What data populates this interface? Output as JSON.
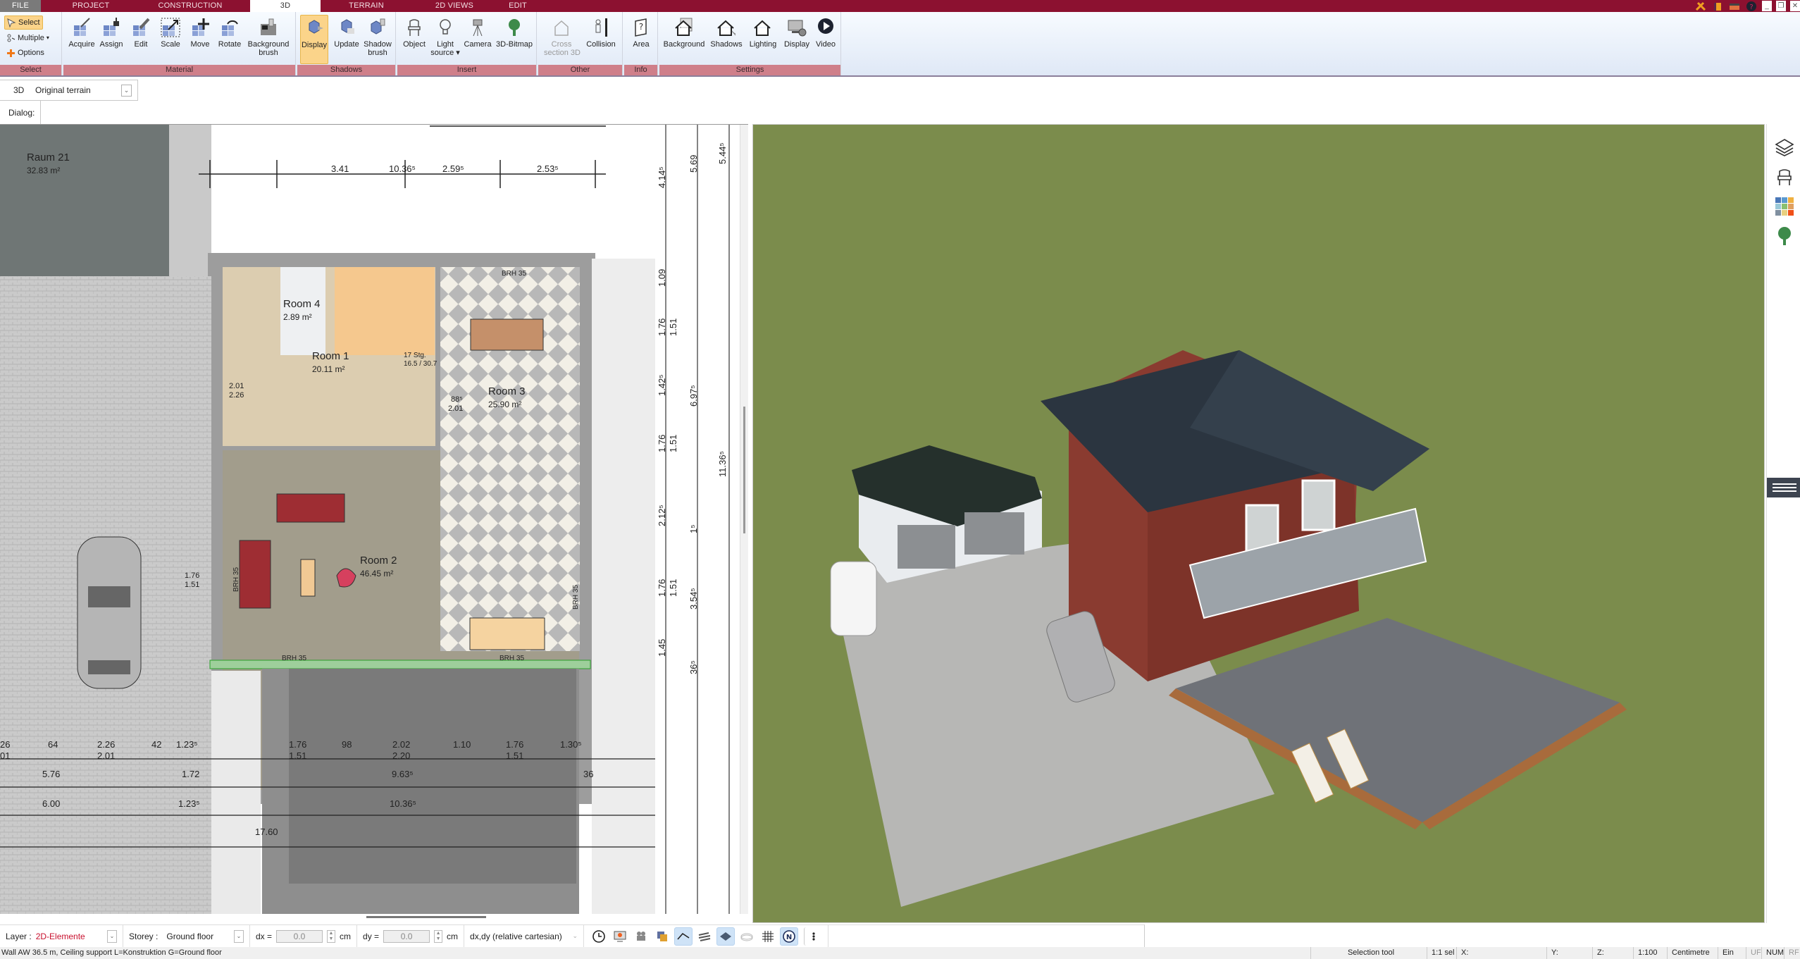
{
  "menubar": {
    "tabs": [
      {
        "label": "FILE"
      },
      {
        "label": "PROJECT"
      },
      {
        "label": "CONSTRUCTION"
      },
      {
        "label": "3D",
        "active": true
      },
      {
        "label": "TERRAIN"
      },
      {
        "label": "2D VIEWS"
      },
      {
        "label": "EDIT"
      }
    ],
    "window_controls": [
      "tools-icon",
      "clipboard-icon",
      "window-icon",
      "help-icon",
      "minimize",
      "restore",
      "close"
    ]
  },
  "ribbon": {
    "select_group": {
      "label": "Select",
      "items": [
        {
          "label": "Select",
          "active": true,
          "icon": "cursor-icon"
        },
        {
          "label": "Multiple",
          "icon": "multiple-select-icon"
        },
        {
          "label": "Options",
          "icon": "plus-icon"
        }
      ]
    },
    "material_group": {
      "label": "Material",
      "buttons": [
        {
          "label": "Acquire",
          "icon": "eyedropper-icon"
        },
        {
          "label": "Assign",
          "icon": "paint-bucket-icon"
        },
        {
          "label": "Edit",
          "icon": "pencil-icon"
        },
        {
          "label": "Scale",
          "icon": "scale-icon"
        },
        {
          "label": "Move",
          "icon": "move-icon"
        },
        {
          "label": "Rotate",
          "icon": "rotate-icon"
        },
        {
          "label": "Background\nbrush",
          "line1": "Background",
          "line2": "brush",
          "icon": "brush-icon"
        }
      ]
    },
    "shadows_group": {
      "label": "Shadows",
      "buttons": [
        {
          "label": "Display",
          "active": true,
          "icon": "cube-display-icon"
        },
        {
          "label": "Update",
          "icon": "cube-update-icon"
        },
        {
          "label": "Shadow brush",
          "line1": "Shadow",
          "line2": "brush",
          "icon": "shadow-brush-icon"
        }
      ]
    },
    "insert_group": {
      "label": "Insert",
      "buttons": [
        {
          "label": "Object",
          "icon": "chair-icon"
        },
        {
          "label": "Light source",
          "line1": "Light",
          "line2": "source ▾",
          "icon": "lightbulb-icon"
        },
        {
          "label": "Camera",
          "icon": "camera-icon"
        },
        {
          "label": "3D-Bitmap",
          "icon": "tree-icon"
        }
      ]
    },
    "other_group": {
      "label": "Other",
      "buttons": [
        {
          "label": "Cross section 3D",
          "line1": "Cross",
          "line2": "section 3D",
          "disabled": true,
          "icon": "cross-section-icon"
        },
        {
          "label": "Collision",
          "icon": "collision-icon"
        }
      ]
    },
    "info_group": {
      "label": "Info",
      "buttons": [
        {
          "label": "Area",
          "icon": "area-question-icon"
        }
      ]
    },
    "settings_group": {
      "label": "Settings",
      "buttons": [
        {
          "label": "Background",
          "icon": "house-background-icon"
        },
        {
          "label": "Shadows",
          "icon": "house-shadows-icon"
        },
        {
          "label": "Lighting",
          "icon": "house-lighting-icon"
        },
        {
          "label": "Display",
          "icon": "monitor-settings-icon"
        },
        {
          "label": "Video",
          "icon": "play-icon"
        }
      ]
    }
  },
  "subtoolbar": {
    "view_label": "3D",
    "terrain_select": "Original terrain",
    "dialog_label": "Dialog:"
  },
  "plan": {
    "rooms": [
      {
        "name": "Raum 21",
        "area": "32.83 m²"
      },
      {
        "name": "Room 4",
        "area": "2.89 m²"
      },
      {
        "name": "Room 1",
        "area": "20.11 m²"
      },
      {
        "name": "Room 3",
        "area": "25.90 m²"
      },
      {
        "name": "Room 2",
        "area": "46.45 m²"
      }
    ],
    "stairs": {
      "steps": "17 Stg.",
      "ratio": "16.5 / 30.7"
    },
    "top_dims": [
      "3.41",
      "10.36⁵",
      "2.59⁵",
      "2.53⁵"
    ],
    "right_dims": [
      "4.14⁵",
      "5.69",
      "5.44⁵",
      "1.09",
      "1.76",
      "1.51",
      "1.42⁵",
      "6.97⁵",
      "1.76",
      "1.51",
      "2.12⁵",
      "11.36⁵",
      "1⁵",
      "1.76",
      "1.51",
      "3.54⁵",
      "1.45",
      "36⁵"
    ],
    "bottom_dims_row1": [
      "26",
      "64",
      "2.26",
      "42",
      "1.23⁵",
      "1.76",
      "98",
      "2.02",
      "1.10",
      "1.76",
      "1.30⁵"
    ],
    "bottom_dims_row1_sub": [
      "01",
      "2.01",
      "1.51",
      "2.20",
      "1.51"
    ],
    "bottom_dims_row2": [
      "5.76",
      "1.72",
      "9.63⁵",
      "36"
    ],
    "bottom_dims_row3": [
      "6.00",
      "1.23⁵",
      "10.36⁵"
    ],
    "misc_dims": [
      "17.60",
      "1.76",
      "1.51",
      "2.01",
      "2.26",
      "88⁵",
      "2.01",
      "2.02",
      "2.20"
    ],
    "brh_labels": [
      "BRH 35",
      "BRH 35",
      "BRH 35",
      "BRH 35",
      "BRH 35"
    ]
  },
  "sidebar_right": {
    "icons": [
      "layers-icon",
      "furniture-icon",
      "materials-palette-icon",
      "plants-icon"
    ]
  },
  "bottombar": {
    "layer_label": "Layer :",
    "layer_value": "2D-Elemente",
    "storey_label": "Storey :",
    "storey_value": "Ground floor",
    "dx_label": "dx =",
    "dx_value": "0.0",
    "dx_unit": "cm",
    "dy_label": "dy =",
    "dy_value": "0.0",
    "dy_unit": "cm",
    "coord_mode": "dx,dy (relative cartesian)",
    "tool_icons": [
      "clock-icon",
      "presentation-icon",
      "video-camera-icon",
      "layers-color-icon",
      "roof-icon",
      "walls-icon",
      "floor-plate-icon",
      "terrain-icon",
      "grid-icon",
      "north-icon",
      "more-icon"
    ]
  },
  "statusbar": {
    "message": "Wall AW 36.5 m, Ceiling support L=Konstruktion G=Ground floor",
    "tool": "Selection tool",
    "sel": "1:1 sel",
    "x": "X:",
    "y": "Y:",
    "z": "Z:",
    "scale": "1:100",
    "unit": "Centimetre",
    "ein": "Ein",
    "uf": "UF",
    "num": "NUM",
    "rf": "RF"
  },
  "colors": {
    "brand": "#8c1130",
    "group_label": "#cf7f8a",
    "active_button": "#fbd48a",
    "grass": "#7b8c4c",
    "brick": "#8a3b30",
    "roof": "#2b3540",
    "layer_text": "#c8102e"
  }
}
